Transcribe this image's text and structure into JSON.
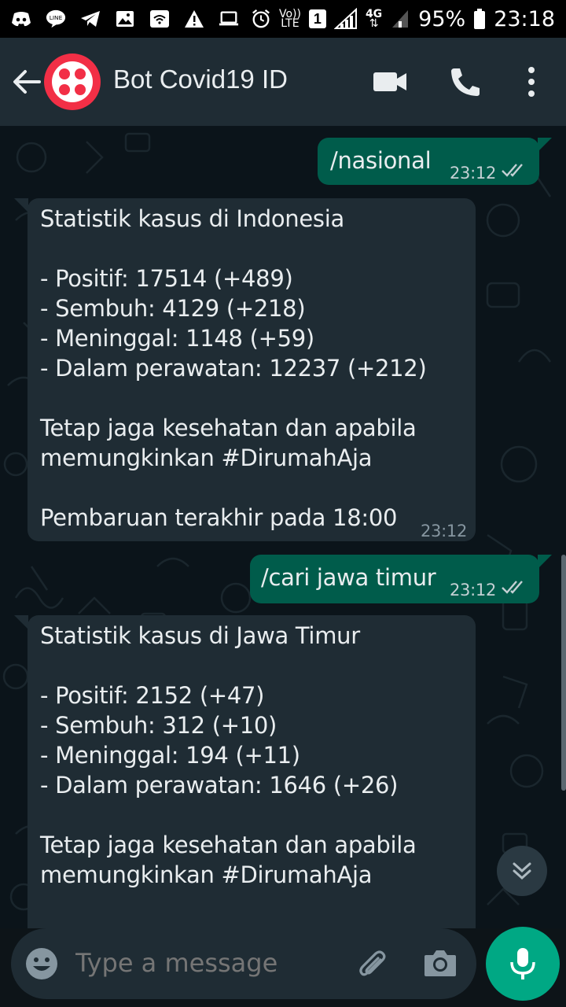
{
  "status_bar": {
    "lte_label_top": "Vo))",
    "lte_label_bottom": "LTE",
    "sim_number": "1",
    "network_label": "4G",
    "battery_percent": "95%",
    "time": "23:18"
  },
  "header": {
    "title": "Bot Covid19 ID"
  },
  "messages": [
    {
      "direction": "out",
      "text": "/nasional",
      "time": "23:12",
      "status": "read"
    },
    {
      "direction": "in",
      "text": "Statistik kasus di Indonesia\n\n- Positif: 17514 (+489)\n- Sembuh: 4129 (+218)\n- Meninggal: 1148 (+59)\n- Dalam perawatan: 12237 (+212)\n\nTetap jaga kesehatan dan apabila\nmemungkinkan #DirumahAja\n\nPembaruan terakhir pada 18:00",
      "time": "23:12"
    },
    {
      "direction": "out",
      "text": "/cari jawa timur",
      "time": "23:12",
      "status": "read"
    },
    {
      "direction": "in",
      "text": "Statistik kasus di Jawa Timur\n\n- Positif: 2152 (+47)\n- Sembuh: 312 (+10)\n- Meninggal: 194 (+11)\n- Dalam perawatan: 1646 (+26)\n\nTetap jaga kesehatan dan apabila\nmemungkinkan #DirumahAja"
    }
  ],
  "composer": {
    "placeholder": "Type a message"
  },
  "colors": {
    "header_bg": "#1f2c34",
    "outgoing_bubble": "#005c4b",
    "incoming_bubble": "#1f2c34",
    "accent": "#00a884",
    "avatar_brand": "#f22f46"
  },
  "icons": {
    "back": "arrow-left-icon",
    "video": "video-camera-icon",
    "call": "phone-icon",
    "menu": "more-vertical-icon",
    "emoji": "emoji-icon",
    "attach": "paperclip-icon",
    "camera": "camera-icon",
    "mic": "microphone-icon",
    "scroll": "double-chevron-down-icon"
  }
}
